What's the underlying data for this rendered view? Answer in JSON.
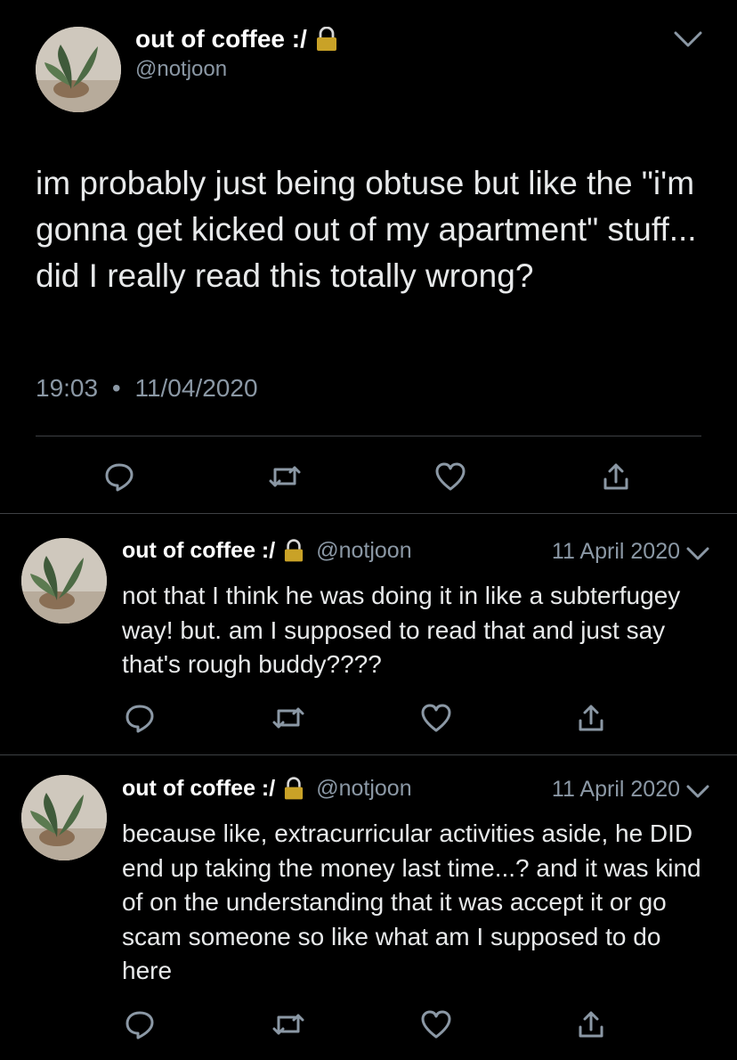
{
  "main_tweet": {
    "display_name": "out of coffee :/",
    "handle": "@notjoon",
    "text": "im probably just being obtuse but like the \"i'm gonna get kicked out of my apartment\" stuff... did I really read this totally wrong?",
    "time": "19:03",
    "separator": "•",
    "date": "11/04/2020"
  },
  "replies": [
    {
      "display_name": "out of coffee :/",
      "handle": "@notjoon",
      "date": "11 April 2020",
      "text": "not that I think he was doing it in like a subterfugey way! but. am I supposed to read that and just say that's rough buddy????"
    },
    {
      "display_name": "out of coffee :/",
      "handle": "@notjoon",
      "date": "11 April 2020",
      "text": "because like, extracurricular activities aside, he DID end up taking the money last time...? and it was kind of on the understanding that it was accept it or go scam someone so like what am I supposed to do here"
    }
  ],
  "icons": {
    "reply": "reply-icon",
    "retweet": "retweet-icon",
    "like": "heart-icon",
    "share": "share-icon",
    "lock": "lock-icon",
    "menu": "chevron-down-icon"
  },
  "colors": {
    "background": "#000000",
    "text": "#e7e9ea",
    "secondary": "#8b98a5",
    "divider": "#3e4144",
    "lock": "#c9a227"
  }
}
